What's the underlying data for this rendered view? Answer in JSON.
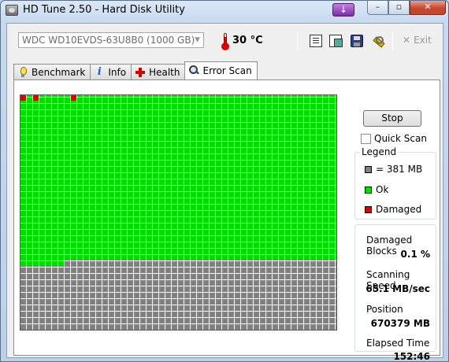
{
  "window": {
    "title": "HD Tune 2.50 - Hard Disk Utility",
    "purple_button_glyph": "↓",
    "min_glyph": "–",
    "max_glyph": "▫",
    "close_glyph": "✕"
  },
  "toolbar": {
    "drive": "WDC WD10EVDS-63U8B0 (1000 GB)",
    "temperature": "30 °C",
    "exit_glyph": "✕",
    "exit_label": "Exit",
    "icons": [
      "copy-info-icon",
      "copy-screenshot-icon",
      "save-icon",
      "options-icon"
    ]
  },
  "tabs": [
    {
      "label": "Benchmark",
      "icon": "benchmark-bulb-icon"
    },
    {
      "label": "Info",
      "icon": "info-icon"
    },
    {
      "label": "Health",
      "icon": "health-cross-icon"
    },
    {
      "label": "Error Scan",
      "icon": "magnifier-icon",
      "active": true
    }
  ],
  "error_scan": {
    "stop_label": "Stop",
    "quick_scan_label": "Quick Scan",
    "quick_scan_checked": false,
    "legend": {
      "title": "Legend",
      "items": [
        {
          "label": "= 381 MB",
          "color": "#808080"
        },
        {
          "label": "Ok",
          "color": "#00dc00"
        },
        {
          "label": "Damaged",
          "color": "#e00000"
        }
      ]
    },
    "stats": [
      {
        "label": "Damaged Blocks",
        "value": "0.1 %"
      },
      {
        "label": "Scanning Speed",
        "value": "65.1 MB/sec"
      },
      {
        "label": "Position",
        "value": "670379 MB"
      },
      {
        "label": "Elapsed Time",
        "value": "152:46"
      }
    ],
    "colors": {
      "ok": "#00dc00",
      "damaged": "#e00000",
      "unscanned": "#808080"
    }
  }
}
